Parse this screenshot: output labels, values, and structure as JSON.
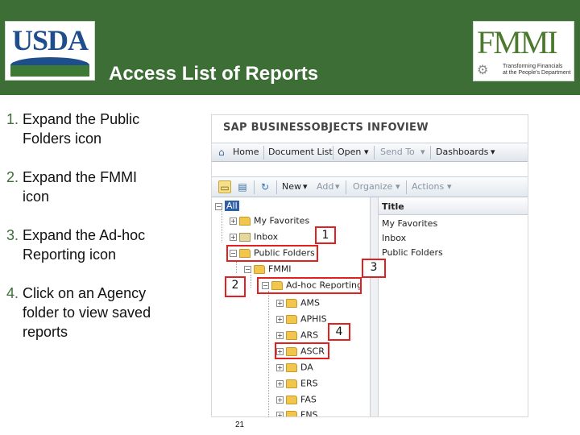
{
  "header": {
    "title": "Access List of Reports",
    "usda_logo_text": "USDA",
    "fmmi_logo_text": "FMMI",
    "fmmi_tagline_line1": "Transforming Financials",
    "fmmi_tagline_line2": "at the People's Department",
    "colors": {
      "band": "#3c6e36",
      "title": "#ffffff"
    }
  },
  "steps": [
    {
      "num": "1.",
      "text": "Expand the Public Folders icon"
    },
    {
      "num": "2.",
      "text": "Expand the FMMI icon"
    },
    {
      "num": "3.",
      "text": "Expand the Ad-hoc Reporting icon"
    },
    {
      "num": "4.",
      "text": "Click on an Agency folder to view saved reports"
    }
  ],
  "screenshot": {
    "app_title": "SAP BUSINESSOBJECTS INFOVIEW",
    "menubar": {
      "home": "Home",
      "document_list": "Document List",
      "open": "Open",
      "send_to": "Send To",
      "dashboards": "Dashboards"
    },
    "toolbar": {
      "new": "New",
      "add": "Add",
      "organize": "Organize",
      "actions": "Actions"
    },
    "tree": {
      "all": "All",
      "my_favorites": "My Favorites",
      "inbox": "Inbox",
      "public_folders": "Public Folders",
      "fmmi": "FMMI",
      "adhoc_reporting": "Ad-hoc Reporting",
      "agencies": [
        "AMS",
        "APHIS",
        "ARS",
        "ASCR",
        "DA",
        "ERS",
        "FAS",
        "FNS"
      ]
    },
    "list": {
      "header": "Title",
      "rows": [
        "My Favorites",
        "Inbox",
        "Public Folders"
      ]
    },
    "callouts": {
      "c1": "1",
      "c2": "2",
      "c3": "3",
      "c4": "4"
    },
    "highlight_color": "#e32020"
  },
  "page_number": "21"
}
